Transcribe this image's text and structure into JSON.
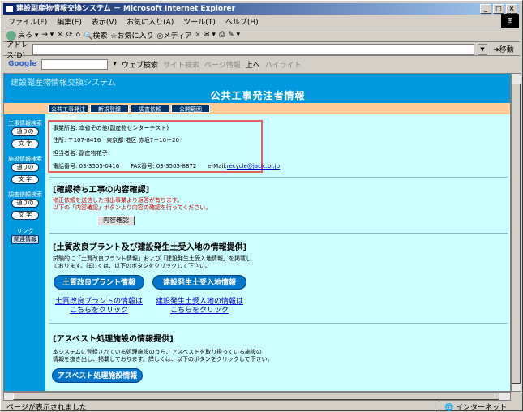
{
  "window": {
    "title": "建設副産物情報交換システム － Microsoft Internet Explorer",
    "menu": [
      "ファイル(F)",
      "編集(E)",
      "表示(V)",
      "お気に入り(A)",
      "ツール(T)",
      "ヘルプ(H)"
    ],
    "toolbar": {
      "back": "戻る",
      "search": "検索",
      "favorites": "お気に入り",
      "media": "メディア"
    },
    "address_label": "アドレス(D)",
    "address_value": "",
    "go": "移動",
    "google": {
      "logo": "Google",
      "search": "ウェブ検索",
      "site": "サイト検索",
      "pageinfo": "ページ情報",
      "up": "上へ",
      "highlight": "ハイライト"
    },
    "status": "ページが表示されました",
    "zone": "インターネット"
  },
  "page": {
    "system_name": "建設副産物情報交換システム",
    "title": "公共工事発注者情報",
    "tabs": [
      "公共工事発注者情報",
      "新規登録",
      "調査依頼",
      "公開範囲"
    ],
    "leftnav": {
      "sections": [
        {
          "heading": "工事情報検索",
          "buttons": [
            "通りの",
            "文 字"
          ]
        },
        {
          "heading": "施設情報検索",
          "buttons": [
            "通りの",
            "文 字"
          ]
        },
        {
          "heading": "調査依頼検索",
          "buttons": [
            "通りの",
            "文 字"
          ]
        }
      ],
      "link_heading": "リンク",
      "link_button": "関連情報"
    },
    "info": {
      "office": "事業所名: 本省その他(副産物センターテスト)",
      "address": "住所: 〒107-8416　東京都 港区 赤坂7－10－20",
      "person": "担当者名: 副産物花子",
      "phone": "電話番号: 03-3505-0416　　FAX番号: 03-3505-8872　　e-Mail:",
      "email": "recycle@jacic.or.jp"
    },
    "confirm": {
      "heading": "[確認待ち工事の内容確認]",
      "note1": "修正依頼を送信した排出事業より返答が有ります。",
      "note2": "以下の「内容確認」ボタンより内容の確認を行ってください。",
      "button": "内容確認"
    },
    "plant": {
      "heading": "[土質改良プラント及び建設発生土受入地の情報提供]",
      "desc1": "試験的に「土質改良プラント情報」および「建設発生土受入地情報」を掲載し",
      "desc2": "ております。詳しくは、以下のボタンをクリックして下さい。",
      "button1": "土質改良プラント情報",
      "button2": "建設発生土受入地情報",
      "link1a": "土質改良プラントの情報は",
      "link1b": "こちらをクリック",
      "link2a": "建設発生土受入地の情報は",
      "link2b": "こちらをクリック"
    },
    "asbestos": {
      "heading": "[アスベスト処理施設の情報提供]",
      "desc1": "本システムに登録されている処理施設のうち、アスベストを取り扱っている施設の",
      "desc2": "情報を抜き出し、掲載しております。詳しくは、以下のボタンをクリックして下さい。",
      "button": "アスベスト処理施設情報"
    }
  }
}
